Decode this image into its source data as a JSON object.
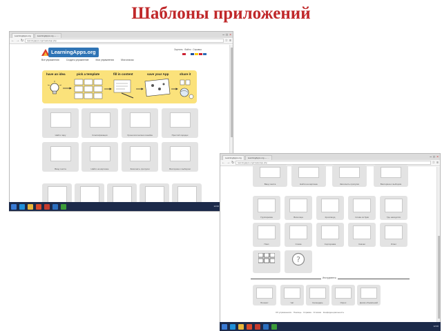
{
  "slide": {
    "title": "Шаблоны приложений"
  },
  "browser1": {
    "tabs": [
      "LearningApps.org",
      "LearningApps.org — ..."
    ],
    "address": "learningapps.org/createApp.php",
    "logo_text": "LearningApps.org",
    "user_text": "Оценить · Войти · Справка",
    "nav": [
      "Все упражнения",
      "Создать упражнение",
      "Мои упражнения",
      "Мои классы"
    ],
    "flag_colors": [
      "#cc2233",
      "#ffffff",
      "#1d4fa0",
      "#ffcc00",
      "#cc2233",
      "#2a6ab5"
    ],
    "banner_steps": [
      "have an idea",
      "pick a template",
      "fill in content",
      "save your App",
      "share it"
    ],
    "templates": [
      "Найти пару",
      "Классификация",
      "Хронологическая линейка",
      "Простой порядок",
      "Ввод текста",
      "Найти на картинке",
      "Заполнить пропуски",
      "Викторина с выбором",
      "",
      "",
      "",
      "",
      ""
    ]
  },
  "browser2": {
    "tabs": [
      "LearningApps.org",
      "LearningApps.org — ..."
    ],
    "address": "learningapps.org/createApp.php",
    "top_captions": [
      "Ввод текста",
      "Найти на картинке",
      "Заполнить пропуски",
      "Викторина с выбором"
    ],
    "row1_captions": [
      "Группировка",
      "Виселица",
      "Кроссворд",
      "Слова из букв",
      "Где находится"
    ],
    "row2_captions": [
      "Пазл",
      "Слова",
      "Сортировка",
      "Скачки",
      "Ответ"
    ],
    "row3_captions": [
      "",
      ""
    ],
    "section_label": "Инструменты",
    "tools_captions": [
      "Блокнот",
      "Чат",
      "Календарь",
      "Опрос",
      "Доска объявлений"
    ],
    "footer": "Об упражнениях · Помощь · Справка · Условия · Конфиденциальность"
  },
  "taskbar": {
    "clock": "12:00"
  }
}
